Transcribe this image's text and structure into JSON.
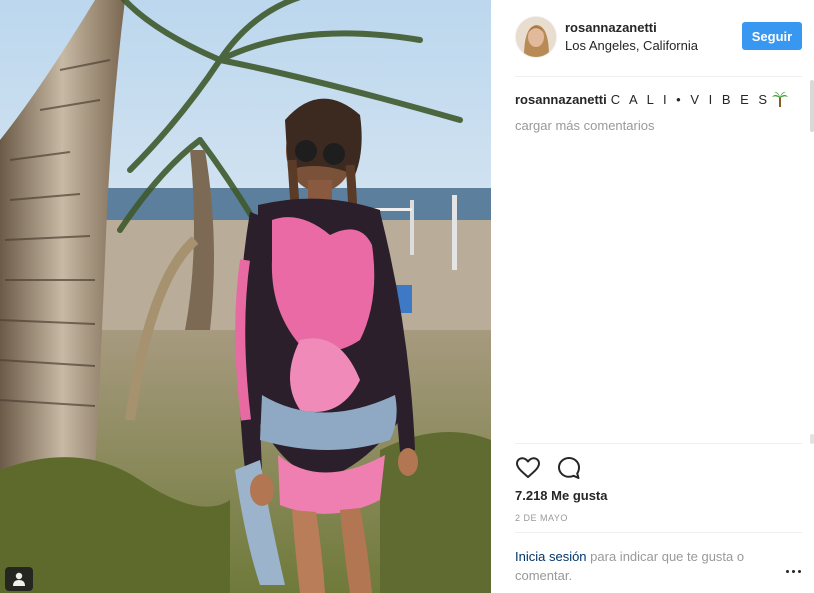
{
  "post": {
    "username": "rosannazanetti",
    "location": "Los Angeles, California",
    "follow_label": "Seguir",
    "caption_user": "rosannazanetti",
    "caption_text": "C A L I • V I B E S",
    "caption_emoji": "palm-tree-icon",
    "load_more": "cargar más comentarios",
    "likes": "7.218 Me gusta",
    "date": "2 DE MAYO",
    "login_link": "Inicia sesión",
    "login_rest": "para indicar que te gusta o comentar."
  },
  "colors": {
    "accent": "#3897f0",
    "link": "#003569",
    "muted": "#999999",
    "text": "#262626",
    "divider": "#efefef"
  }
}
